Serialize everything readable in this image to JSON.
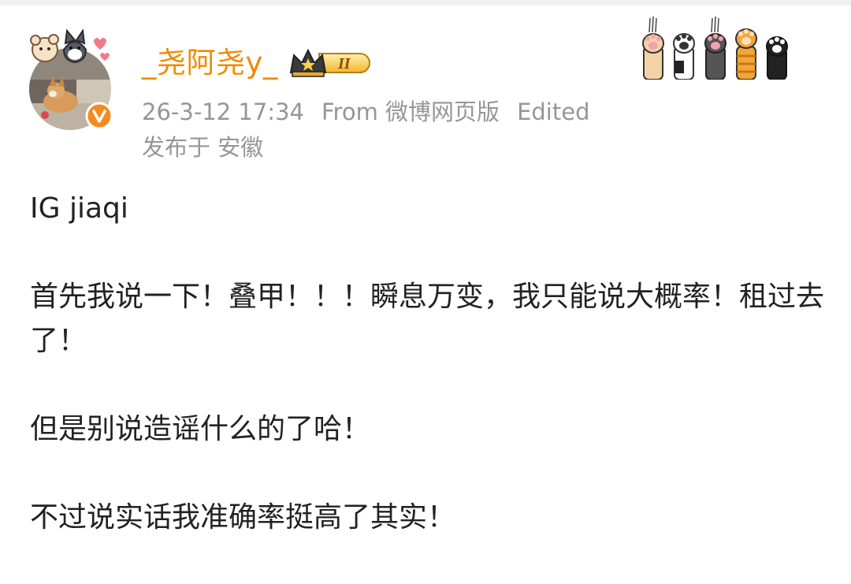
{
  "post": {
    "username": "_尧阿尧y_",
    "vip_level": "II",
    "timestamp": "26-3-12 17:34",
    "source": "From 微博网页版",
    "edited": "Edited",
    "location": "发布于 安徽",
    "paragraphs": [
      "IG jiaqi",
      "首先我说一下！叠甲！！！瞬息万变，我只能说大概率！租过去了！",
      "但是别说造谣什么的了哈！",
      "不过说实话我准确率挺高了其实！"
    ]
  },
  "icons": {
    "avatar": "user-avatar-dog",
    "verified": "verified-orange-v-icon",
    "vip": "crown-vip-badge-icon",
    "decoration": "cat-paws-decoration"
  },
  "colors": {
    "username": "#f08a00",
    "meta": "#969696",
    "body_text": "#222222",
    "verified": "#f58a1f"
  }
}
